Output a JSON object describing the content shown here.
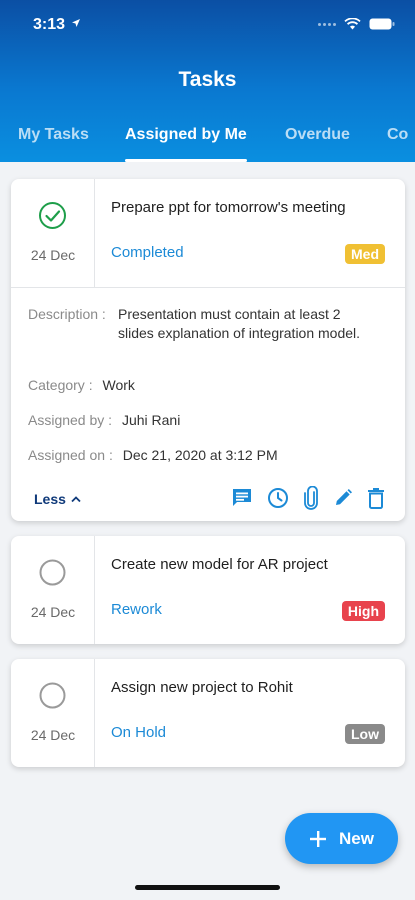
{
  "status_bar": {
    "time": "3:13"
  },
  "header": {
    "title": "Tasks"
  },
  "tabs": [
    {
      "label": "My Tasks"
    },
    {
      "label": "Assigned by Me"
    },
    {
      "label": "Overdue"
    },
    {
      "label": "Co"
    }
  ],
  "tasks": [
    {
      "title": "Prepare ppt for tomorrow's meeting",
      "date": "24 Dec",
      "status": "Completed",
      "priority": "Med",
      "priority_color": "#f0c033",
      "completed": true,
      "details": {
        "description_label": "Description :",
        "description": "Presentation must contain at least 2 slides explanation of integration model.",
        "category_label": "Category :",
        "category": "Work",
        "assigned_by_label": "Assigned by :",
        "assigned_by": "Juhi Rani",
        "assigned_on_label": "Assigned on :",
        "assigned_on": "Dec 21, 2020 at 3:12 PM",
        "less_label": "Less"
      }
    },
    {
      "title": "Create new model for AR project",
      "date": "24 Dec",
      "status": "Rework",
      "priority": "High",
      "priority_color": "#e8434d",
      "completed": false
    },
    {
      "title": "Assign new project to Rohit",
      "date": "24 Dec",
      "status": "On Hold",
      "priority": "Low",
      "priority_color": "#8a8a8a",
      "completed": false
    }
  ],
  "fab": {
    "label": "New"
  },
  "colors": {
    "accent": "#1c8ad6",
    "header_top": "#0b4fa4",
    "header_bottom": "#0a8fe0",
    "success": "#1e9e4a"
  }
}
